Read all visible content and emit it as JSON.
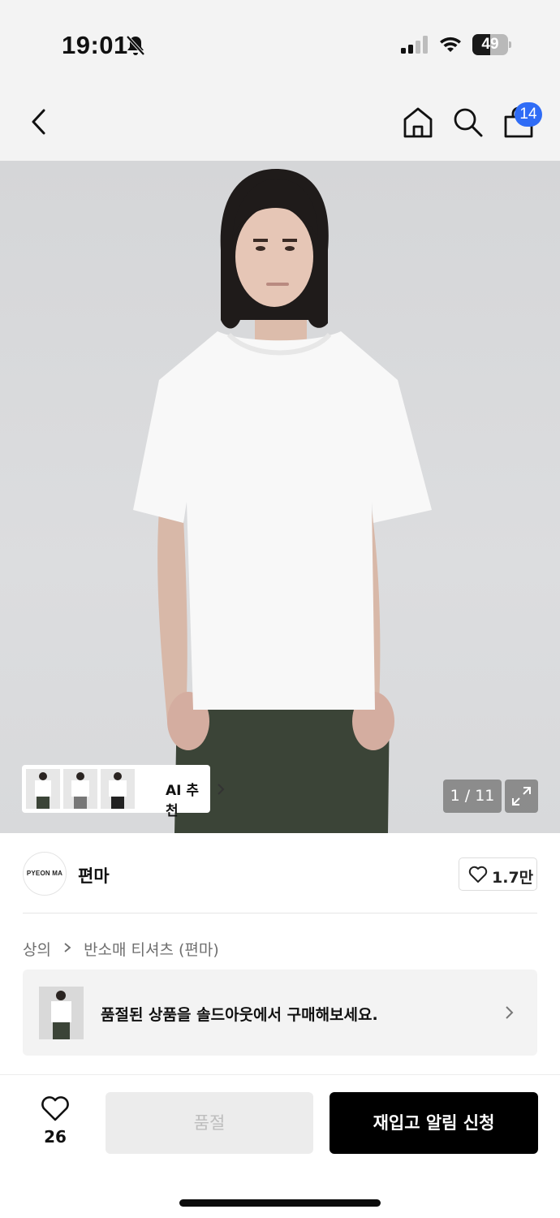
{
  "status_bar": {
    "time": "19:01",
    "battery_level": "49",
    "battery_fraction": 0.49
  },
  "nav": {
    "cart_count": "14",
    "badge_color": "#2f6cf6"
  },
  "gallery": {
    "ai_label": "AI 추천",
    "counter": "1 / 11"
  },
  "brand": {
    "logo_text": "PYEON MA",
    "name": "편마",
    "like_count": "1.7만"
  },
  "breadcrumb": {
    "category": "상의",
    "subcategory": "반소매 티셔츠 (편마)"
  },
  "soldout_banner": {
    "text": "품절된 상품을 솔드아웃에서 구매해보세요."
  },
  "bottom_bar": {
    "wish_count": "26",
    "soldout_label": "품절",
    "restock_label": "재입고 알림 신청"
  },
  "icons": [
    "bell-slash-icon",
    "signal-icon",
    "wifi-icon",
    "battery-icon",
    "back-icon",
    "home-icon",
    "search-icon",
    "bag-icon",
    "chevron-right-icon",
    "expand-icon",
    "heart-icon"
  ]
}
